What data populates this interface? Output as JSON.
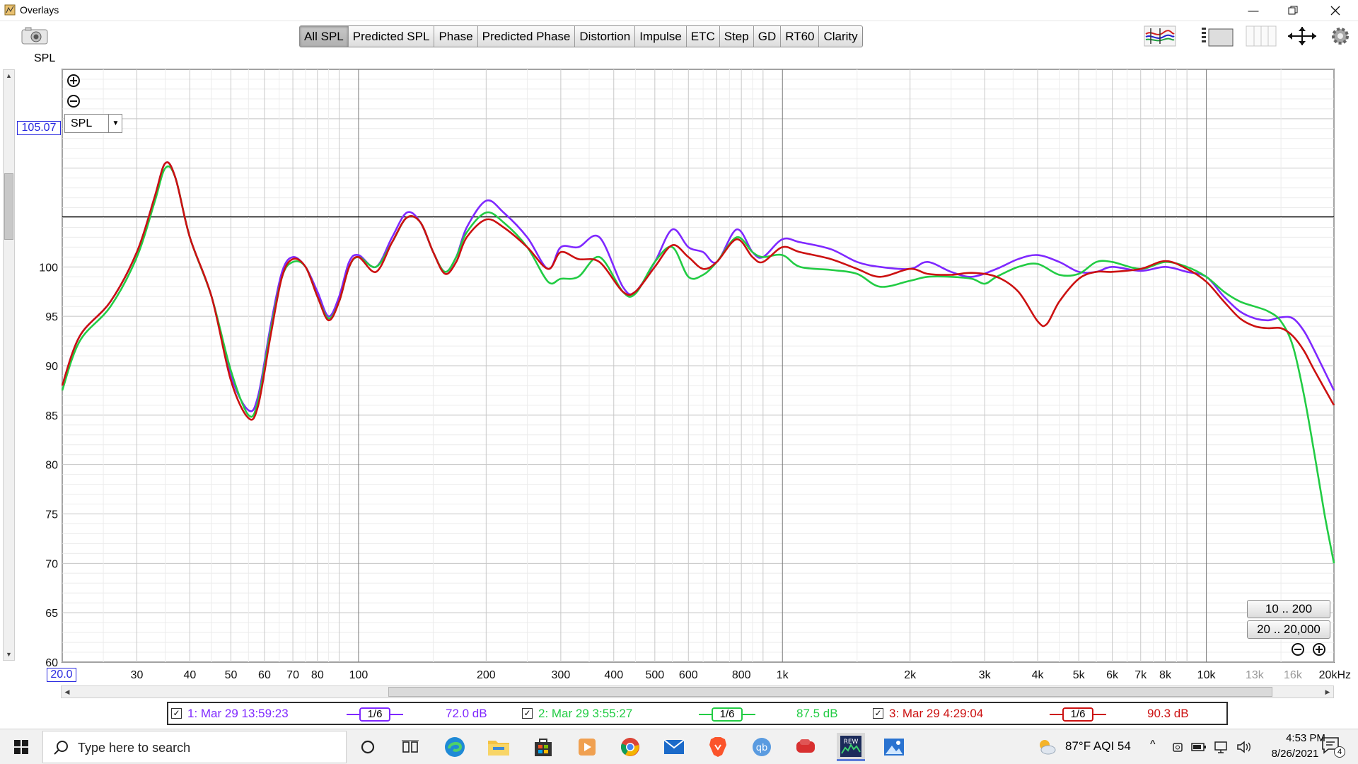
{
  "window": {
    "title": "Overlays"
  },
  "toolbar": {
    "tabs": [
      {
        "label": "All SPL",
        "active": true
      },
      {
        "label": "Predicted SPL"
      },
      {
        "label": "Phase"
      },
      {
        "label": "Predicted Phase"
      },
      {
        "label": "Distortion"
      },
      {
        "label": "Impulse"
      },
      {
        "label": "ETC"
      },
      {
        "label": "Step"
      },
      {
        "label": "GD"
      },
      {
        "label": "RT60"
      },
      {
        "label": "Clarity"
      }
    ],
    "spl_label": "SPL"
  },
  "graph": {
    "select_value": "SPL",
    "cursor_value": "105.07",
    "x_start": "20.0",
    "range_buttons": [
      "10 .. 200",
      "20 .. 20,000"
    ]
  },
  "chart_data": {
    "type": "line",
    "xscale": "log",
    "xlim": [
      20,
      20000
    ],
    "ylim": [
      60,
      120
    ],
    "grid": true,
    "ytick_labels": [
      "60",
      "65",
      "70",
      "75",
      "80",
      "85",
      "90",
      "95",
      "100"
    ],
    "ytick_values": [
      60,
      65,
      70,
      75,
      80,
      85,
      90,
      95,
      100
    ],
    "xtick_labels": [
      "30",
      "40",
      "50",
      "60",
      "70",
      "80",
      "100",
      "200",
      "300",
      "400",
      "500",
      "600",
      "800",
      "1k",
      "2k",
      "3k",
      "4k",
      "5k",
      "6k",
      "7k",
      "8k",
      "10k",
      "13k",
      "16k",
      "20kHz"
    ],
    "xtick_values": [
      30,
      40,
      50,
      60,
      70,
      80,
      100,
      200,
      300,
      400,
      500,
      600,
      800,
      1000,
      2000,
      3000,
      4000,
      5000,
      6000,
      7000,
      8000,
      10000,
      13000,
      16000,
      20000
    ],
    "cursor_line_y": 105.07,
    "series": [
      {
        "name": "1: Mar 29 13:59:23",
        "color": "#7f28ff",
        "points": [
          [
            20,
            88
          ],
          [
            22,
            93
          ],
          [
            26,
            96.5
          ],
          [
            30,
            101.5
          ],
          [
            33,
            107
          ],
          [
            35,
            110.5
          ],
          [
            37,
            109
          ],
          [
            40,
            103
          ],
          [
            45,
            97
          ],
          [
            50,
            89
          ],
          [
            55,
            85.5
          ],
          [
            58,
            87
          ],
          [
            62,
            94
          ],
          [
            66,
            99.5
          ],
          [
            70,
            101
          ],
          [
            75,
            100
          ],
          [
            80,
            97.5
          ],
          [
            85,
            95
          ],
          [
            90,
            97
          ],
          [
            95,
            100.5
          ],
          [
            100,
            101.2
          ],
          [
            110,
            100
          ],
          [
            120,
            103
          ],
          [
            130,
            105.5
          ],
          [
            140,
            104.5
          ],
          [
            150,
            101.5
          ],
          [
            160,
            99.5
          ],
          [
            170,
            101
          ],
          [
            180,
            104
          ],
          [
            200,
            106.7
          ],
          [
            220,
            105.5
          ],
          [
            250,
            103
          ],
          [
            280,
            99.8
          ],
          [
            300,
            102
          ],
          [
            330,
            102
          ],
          [
            370,
            103
          ],
          [
            420,
            98
          ],
          [
            450,
            97.5
          ],
          [
            500,
            100.5
          ],
          [
            550,
            103.8
          ],
          [
            600,
            102
          ],
          [
            650,
            101.5
          ],
          [
            700,
            100.5
          ],
          [
            780,
            103.8
          ],
          [
            850,
            101.5
          ],
          [
            900,
            101
          ],
          [
            1000,
            102.8
          ],
          [
            1100,
            102.5
          ],
          [
            1300,
            101.8
          ],
          [
            1500,
            100.5
          ],
          [
            1700,
            100
          ],
          [
            2000,
            99.8
          ],
          [
            2200,
            100.5
          ],
          [
            2500,
            99.5
          ],
          [
            2800,
            99
          ],
          [
            3200,
            99.8
          ],
          [
            3600,
            100.8
          ],
          [
            4000,
            101.2
          ],
          [
            4500,
            100.5
          ],
          [
            5000,
            99.5
          ],
          [
            5500,
            99.5
          ],
          [
            6000,
            100
          ],
          [
            7000,
            99.6
          ],
          [
            8000,
            100
          ],
          [
            9000,
            99.5
          ],
          [
            10000,
            99
          ],
          [
            11000,
            97
          ],
          [
            12000,
            95.5
          ],
          [
            13000,
            94.8
          ],
          [
            14000,
            94.6
          ],
          [
            15000,
            94.9
          ],
          [
            16000,
            94.8
          ],
          [
            17000,
            93.5
          ],
          [
            18000,
            91.5
          ],
          [
            20000,
            87.5
          ]
        ]
      },
      {
        "name": "2: Mar 29 3:55:27",
        "color": "#22cc44",
        "points": [
          [
            20,
            87.5
          ],
          [
            22,
            92.5
          ],
          [
            26,
            96
          ],
          [
            30,
            101
          ],
          [
            33,
            106.5
          ],
          [
            35,
            110
          ],
          [
            37,
            109
          ],
          [
            40,
            103
          ],
          [
            45,
            97
          ],
          [
            50,
            89.5
          ],
          [
            55,
            85
          ],
          [
            58,
            86.5
          ],
          [
            62,
            93.5
          ],
          [
            66,
            99
          ],
          [
            70,
            100.5
          ],
          [
            75,
            100
          ],
          [
            80,
            97
          ],
          [
            85,
            94.8
          ],
          [
            90,
            96.5
          ],
          [
            95,
            100
          ],
          [
            100,
            101
          ],
          [
            110,
            100
          ],
          [
            120,
            102.5
          ],
          [
            130,
            105
          ],
          [
            140,
            104.5
          ],
          [
            150,
            101.5
          ],
          [
            160,
            99.5
          ],
          [
            170,
            101
          ],
          [
            180,
            103.5
          ],
          [
            200,
            105.5
          ],
          [
            220,
            104.5
          ],
          [
            250,
            102
          ],
          [
            280,
            98.5
          ],
          [
            300,
            98.8
          ],
          [
            330,
            99
          ],
          [
            370,
            101
          ],
          [
            420,
            97.5
          ],
          [
            450,
            97.3
          ],
          [
            500,
            100.5
          ],
          [
            550,
            102
          ],
          [
            600,
            99
          ],
          [
            650,
            99.2
          ],
          [
            700,
            100.5
          ],
          [
            780,
            103
          ],
          [
            850,
            101.5
          ],
          [
            900,
            101
          ],
          [
            1000,
            101.2
          ],
          [
            1100,
            100
          ],
          [
            1300,
            99.7
          ],
          [
            1500,
            99.3
          ],
          [
            1700,
            98
          ],
          [
            2000,
            98.6
          ],
          [
            2200,
            99
          ],
          [
            2500,
            99
          ],
          [
            2800,
            98.8
          ],
          [
            3000,
            98.3
          ],
          [
            3200,
            99
          ],
          [
            3600,
            100
          ],
          [
            4000,
            100.3
          ],
          [
            4500,
            99.2
          ],
          [
            5000,
            99.3
          ],
          [
            5500,
            100.5
          ],
          [
            6000,
            100.5
          ],
          [
            7000,
            99.8
          ],
          [
            8000,
            100.5
          ],
          [
            9000,
            100
          ],
          [
            10000,
            99
          ],
          [
            11000,
            97.5
          ],
          [
            12000,
            96.5
          ],
          [
            13000,
            96
          ],
          [
            14000,
            95.5
          ],
          [
            15000,
            94.5
          ],
          [
            16000,
            92
          ],
          [
            17000,
            87
          ],
          [
            18000,
            81
          ],
          [
            19000,
            75
          ],
          [
            20000,
            70
          ]
        ]
      },
      {
        "name": "3: Mar 29 4:29:04",
        "color": "#cc1111",
        "points": [
          [
            20,
            88
          ],
          [
            22,
            93
          ],
          [
            26,
            96.5
          ],
          [
            30,
            101.5
          ],
          [
            33,
            107
          ],
          [
            35,
            110.5
          ],
          [
            37,
            109
          ],
          [
            40,
            103
          ],
          [
            45,
            97
          ],
          [
            50,
            88.5
          ],
          [
            55,
            84.7
          ],
          [
            58,
            86
          ],
          [
            62,
            93
          ],
          [
            66,
            99
          ],
          [
            70,
            100.8
          ],
          [
            75,
            100
          ],
          [
            80,
            97
          ],
          [
            85,
            94.6
          ],
          [
            90,
            96.5
          ],
          [
            95,
            100
          ],
          [
            100,
            101
          ],
          [
            110,
            99.5
          ],
          [
            120,
            102.5
          ],
          [
            130,
            105
          ],
          [
            140,
            104.5
          ],
          [
            150,
            101.5
          ],
          [
            160,
            99.3
          ],
          [
            170,
            100.5
          ],
          [
            180,
            103
          ],
          [
            200,
            104.8
          ],
          [
            220,
            104
          ],
          [
            250,
            102
          ],
          [
            280,
            99.8
          ],
          [
            300,
            101.5
          ],
          [
            330,
            100.8
          ],
          [
            370,
            100.5
          ],
          [
            420,
            97.5
          ],
          [
            450,
            97.5
          ],
          [
            500,
            100
          ],
          [
            550,
            102.2
          ],
          [
            600,
            101
          ],
          [
            650,
            99.8
          ],
          [
            700,
            100.5
          ],
          [
            780,
            102.8
          ],
          [
            850,
            101
          ],
          [
            900,
            100.5
          ],
          [
            1000,
            102
          ],
          [
            1100,
            101.5
          ],
          [
            1300,
            100.8
          ],
          [
            1500,
            99.8
          ],
          [
            1700,
            99
          ],
          [
            2000,
            99.8
          ],
          [
            2200,
            99.3
          ],
          [
            2500,
            99.2
          ],
          [
            2800,
            99.4
          ],
          [
            3200,
            99
          ],
          [
            3600,
            97.5
          ],
          [
            4000,
            94.5
          ],
          [
            4200,
            94.2
          ],
          [
            4500,
            96.5
          ],
          [
            5000,
            98.8
          ],
          [
            5500,
            99.5
          ],
          [
            6000,
            99.5
          ],
          [
            7000,
            99.8
          ],
          [
            8000,
            100.6
          ],
          [
            9000,
            99.8
          ],
          [
            10000,
            98.5
          ],
          [
            11000,
            96.5
          ],
          [
            12000,
            94.8
          ],
          [
            13000,
            94
          ],
          [
            14000,
            93.8
          ],
          [
            15000,
            93.8
          ],
          [
            16000,
            93
          ],
          [
            17000,
            91.5
          ],
          [
            18000,
            89.5
          ],
          [
            20000,
            86
          ]
        ]
      }
    ]
  },
  "legend": [
    {
      "label": "1: Mar 29 13:59:23",
      "smoothing": "1/6",
      "level": "72.0 dB",
      "color": "#7f28ff",
      "checked": "✓"
    },
    {
      "label": "2: Mar 29 3:55:27",
      "smoothing": "1/6",
      "level": "87.5 dB",
      "color": "#22cc44",
      "checked": "✓"
    },
    {
      "label": "3: Mar 29 4:29:04",
      "smoothing": "1/6",
      "level": "90.3 dB",
      "color": "#cc1111",
      "checked": "✓"
    }
  ],
  "taskbar": {
    "search_placeholder": "Type here to search",
    "weather": "87°F  AQI 54",
    "time": "4:53 PM",
    "date": "8/26/2021",
    "notifications": "4"
  }
}
